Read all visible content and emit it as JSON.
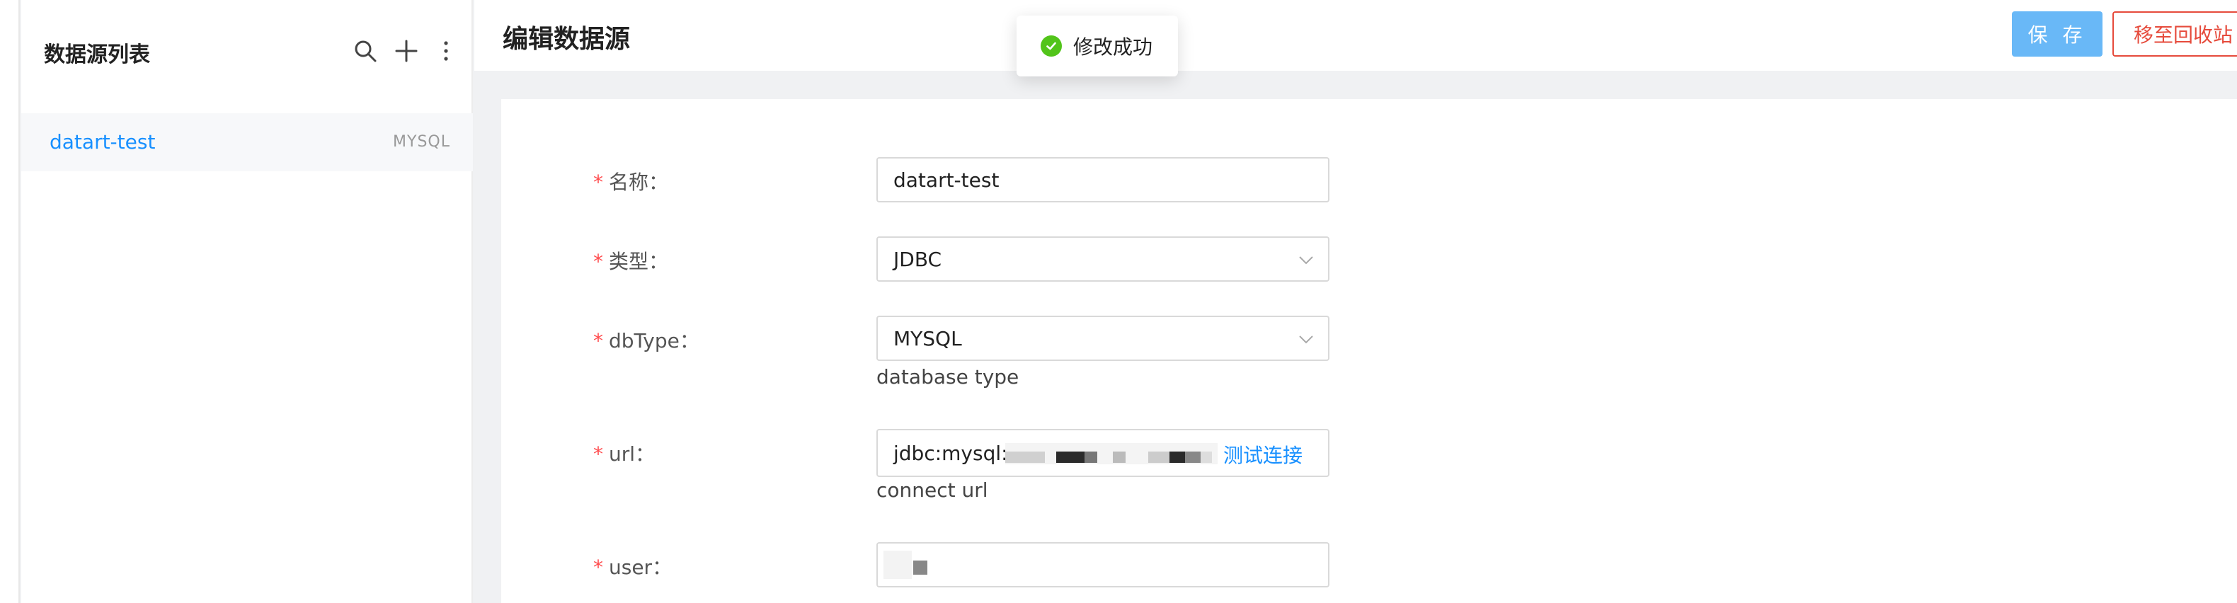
{
  "sidebar": {
    "title": "数据源列表",
    "items": [
      {
        "name": "datart-test",
        "type": "MYSQL"
      }
    ]
  },
  "header": {
    "title": "编辑数据源",
    "save_label": "保 存",
    "trash_label": "移至回收站"
  },
  "toast": {
    "message": "修改成功"
  },
  "form": {
    "name": {
      "label": "名称：",
      "value": "datart-test"
    },
    "type": {
      "label": "类型：",
      "value": "JDBC"
    },
    "dbType": {
      "label": "dbType：",
      "value": "MYSQL",
      "help": "database type"
    },
    "url": {
      "label": "url：",
      "value": "jdbc:mysql:/",
      "help": "connect url",
      "action": "测试连接"
    },
    "user": {
      "label": "user："
    }
  },
  "required_mark": "*",
  "colors": {
    "accent": "#1890ff",
    "save_button": "#69b8f7",
    "danger": "#e64b3c",
    "success": "#52c41a",
    "required": "#ff4d4f"
  },
  "icons": [
    "search-icon",
    "plus-icon",
    "more-vertical-icon",
    "chevron-down-icon",
    "check-circle-icon"
  ]
}
